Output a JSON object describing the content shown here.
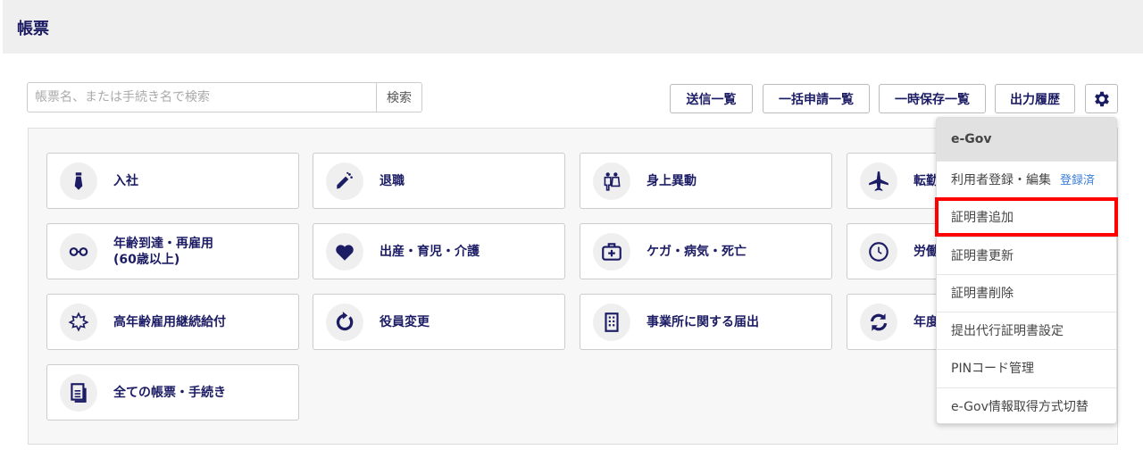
{
  "header": {
    "title": "帳票"
  },
  "search": {
    "placeholder": "帳票名、または手続き名で検索",
    "button": "検索"
  },
  "toolbar": {
    "sent_list": "送信一覧",
    "bulk_list": "一括申請一覧",
    "temp_list": "一時保存一覧",
    "output_history": "出力履歴",
    "settings_icon": "gear-icon"
  },
  "cards": [
    {
      "label": "入社",
      "icon": "necktie"
    },
    {
      "label": "退職",
      "icon": "bouquet"
    },
    {
      "label": "身上異動",
      "icon": "couple"
    },
    {
      "label": "転勤",
      "icon": "airplane"
    },
    {
      "label": "年齢到達・再雇用",
      "label2": "(60歳以上)",
      "icon": "glasses"
    },
    {
      "label": "出産・育児・介護",
      "icon": "heart"
    },
    {
      "label": "ケガ・病気・死亡",
      "icon": "first-aid"
    },
    {
      "label": "労働",
      "icon": "clock"
    },
    {
      "label": "高年齢雇用継続給付",
      "icon": "maple-leaf"
    },
    {
      "label": "役員変更",
      "icon": "rotate"
    },
    {
      "label": "事業所に関する届出",
      "icon": "building"
    },
    {
      "label": "年度",
      "icon": "sync"
    },
    {
      "label": "全ての帳票・手続き",
      "icon": "documents"
    }
  ],
  "menu": {
    "header": "e-Gov",
    "items": [
      {
        "label": "利用者登録・編集",
        "badge": "登録済"
      },
      {
        "label": "証明書追加"
      },
      {
        "label": "証明書更新"
      },
      {
        "label": "証明書削除"
      },
      {
        "label": "提出代行証明書設定"
      },
      {
        "label": "PINコード管理"
      },
      {
        "label": "e-Gov情報取得方式切替"
      }
    ]
  },
  "colors": {
    "navy": "#1c1c64",
    "highlight": "#ff0000",
    "badge": "#3b7dd8"
  }
}
